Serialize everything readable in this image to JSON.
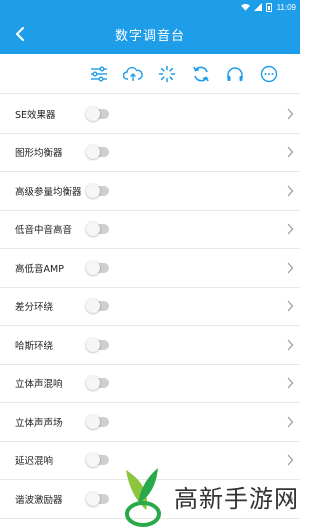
{
  "status_bar": {
    "time": "11:09"
  },
  "header": {
    "title": "数字调音台"
  },
  "toolbar": {
    "icons": [
      "sliders-icon",
      "cloud-upload-icon",
      "loading-icon",
      "sync-icon",
      "headphones-icon",
      "more-icon"
    ]
  },
  "colors": {
    "primary": "#1E9DE8"
  },
  "list": {
    "items": [
      {
        "label": "SE效果器",
        "enabled": false
      },
      {
        "label": "图形均衡器",
        "enabled": false
      },
      {
        "label": "高级参量均衡器",
        "enabled": false
      },
      {
        "label": "低音中音高音",
        "enabled": false
      },
      {
        "label": "高低音AMP",
        "enabled": false
      },
      {
        "label": "差分环绕",
        "enabled": false
      },
      {
        "label": "哈斯环绕",
        "enabled": false
      },
      {
        "label": "立体声混响",
        "enabled": false
      },
      {
        "label": "立体声声场",
        "enabled": false
      },
      {
        "label": "延迟混响",
        "enabled": false
      },
      {
        "label": "谐波激励器",
        "enabled": false
      }
    ]
  },
  "watermark": {
    "text": "高新手游网"
  }
}
